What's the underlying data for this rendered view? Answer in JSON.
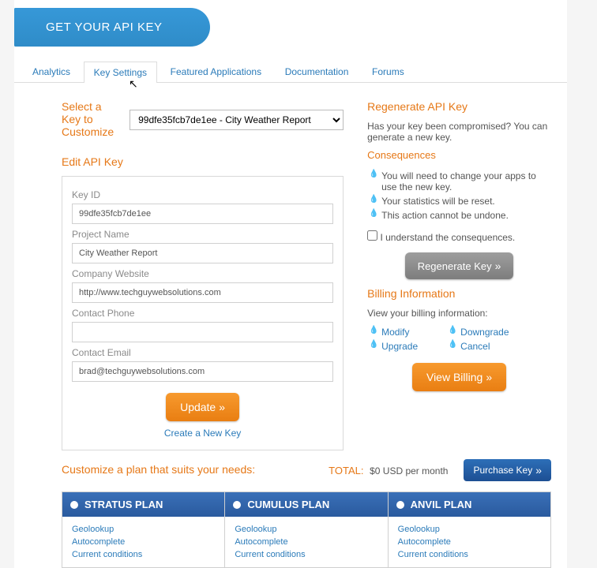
{
  "banner": {
    "title": "GET YOUR API KEY"
  },
  "tabs": [
    "Analytics",
    "Key Settings",
    "Featured Applications",
    "Documentation",
    "Forums"
  ],
  "selectKey": {
    "label": "Select a Key to Customize",
    "selected": "99dfe35fcb7de1ee - City Weather Report"
  },
  "edit": {
    "heading": "Edit API Key",
    "fields": {
      "keyId": {
        "label": "Key ID",
        "value": "99dfe35fcb7de1ee"
      },
      "projectName": {
        "label": "Project Name",
        "value": "City Weather Report"
      },
      "companyWebsite": {
        "label": "Company Website",
        "value": "http://www.techguywebsolutions.com"
      },
      "contactPhone": {
        "label": "Contact Phone",
        "value": ""
      },
      "contactEmail": {
        "label": "Contact Email",
        "value": "brad@techguywebsolutions.com"
      }
    },
    "updateBtn": "Update",
    "createNew": "Create a New Key"
  },
  "regen": {
    "heading": "Regenerate API Key",
    "prompt": "Has your key been compromised? You can generate a new key.",
    "consequencesHead": "Consequences",
    "consequences": [
      "You will need to change your apps to use the new key.",
      "Your statistics will be reset.",
      "This action cannot be undone."
    ],
    "ack": "I understand the consequences.",
    "btn": "Regenerate Key"
  },
  "billing": {
    "heading": "Billing Information",
    "prompt": "View your billing information:",
    "links1": [
      "Modify",
      "Upgrade"
    ],
    "links2": [
      "Downgrade",
      "Cancel"
    ],
    "btn": "View Billing"
  },
  "customize": {
    "heading": "Customize a plan that suits your needs:",
    "totalLabel": "TOTAL:",
    "totalValue": "$0 USD per month",
    "purchaseBtn": "Purchase Key"
  },
  "plans": [
    {
      "name": "STRATUS PLAN",
      "features": [
        "Geolookup",
        "Autocomplete",
        "Current conditions"
      ]
    },
    {
      "name": "CUMULUS PLAN",
      "features": [
        "Geolookup",
        "Autocomplete",
        "Current conditions"
      ]
    },
    {
      "name": "ANVIL PLAN",
      "features": [
        "Geolookup",
        "Autocomplete",
        "Current conditions"
      ]
    }
  ]
}
